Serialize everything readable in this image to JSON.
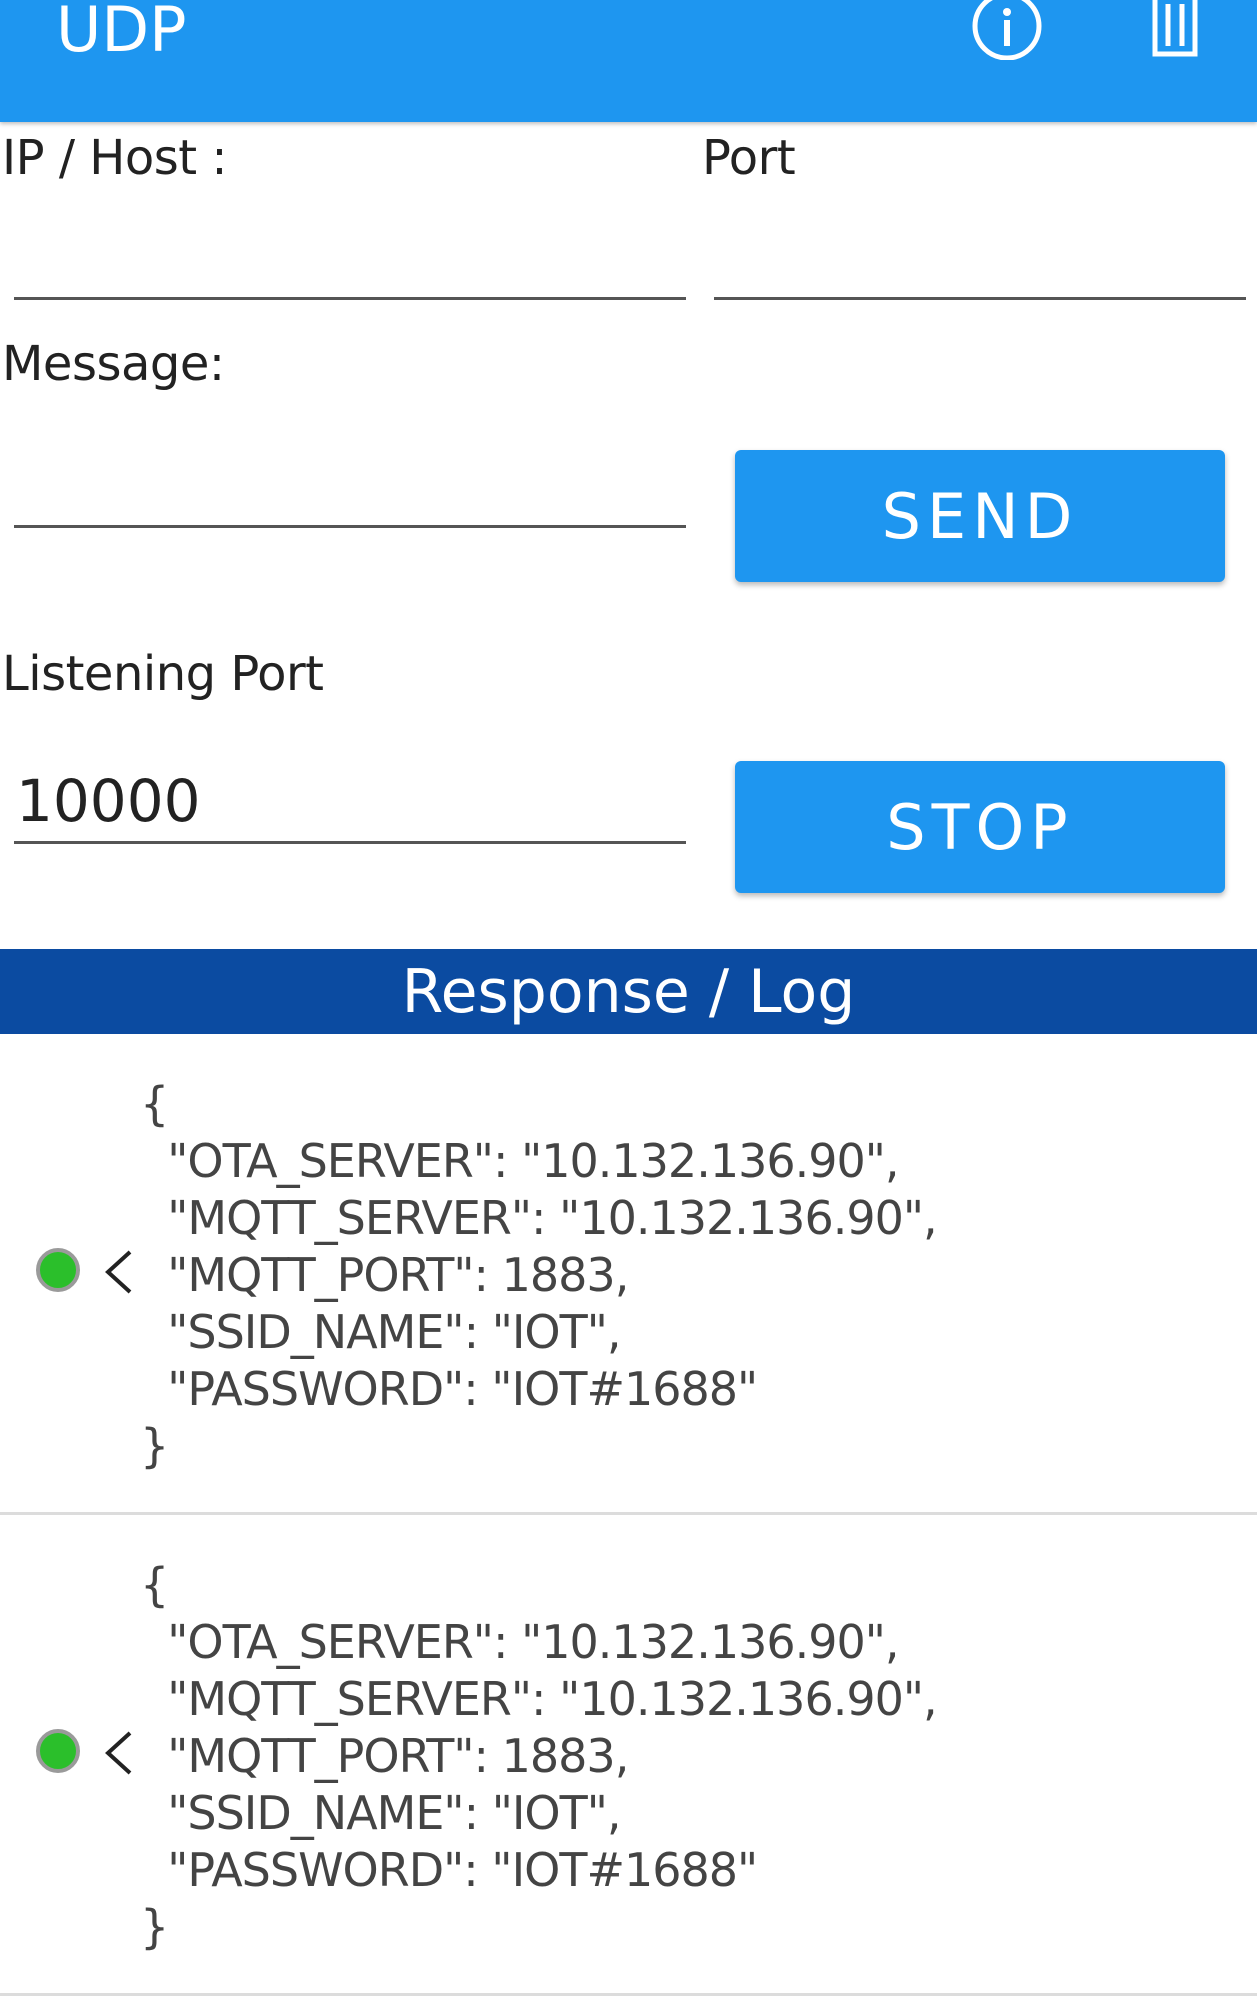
{
  "appbar": {
    "title": "UDP",
    "icons": [
      "info-icon",
      "trash-icon"
    ],
    "background": "#1e96f0"
  },
  "form": {
    "host_label": "IP / Host :",
    "host_value": "",
    "port_label": "Port",
    "port_value": "",
    "message_label": "Message:",
    "message_value": "",
    "send_label": "SEND",
    "listening_port_label": "Listening Port",
    "listening_port_value": "10000",
    "stop_label": "STOP"
  },
  "log": {
    "header": "Response / Log",
    "header_color": "#0b4ba1",
    "entries": [
      {
        "status": "green",
        "direction": "incoming",
        "text": "{\n  \"OTA_SERVER\": \"10.132.136.90\",\n  \"MQTT_SERVER\": \"10.132.136.90\",\n  \"MQTT_PORT\": 1883,\n  \"SSID_NAME\": \"IOT\",\n  \"PASSWORD\": \"IOT#1688\"\n}"
      },
      {
        "status": "green",
        "direction": "incoming",
        "text": "{\n  \"OTA_SERVER\": \"10.132.136.90\",\n  \"MQTT_SERVER\": \"10.132.136.90\",\n  \"MQTT_PORT\": 1883,\n  \"SSID_NAME\": \"IOT\",\n  \"PASSWORD\": \"IOT#1688\"\n}"
      }
    ]
  }
}
